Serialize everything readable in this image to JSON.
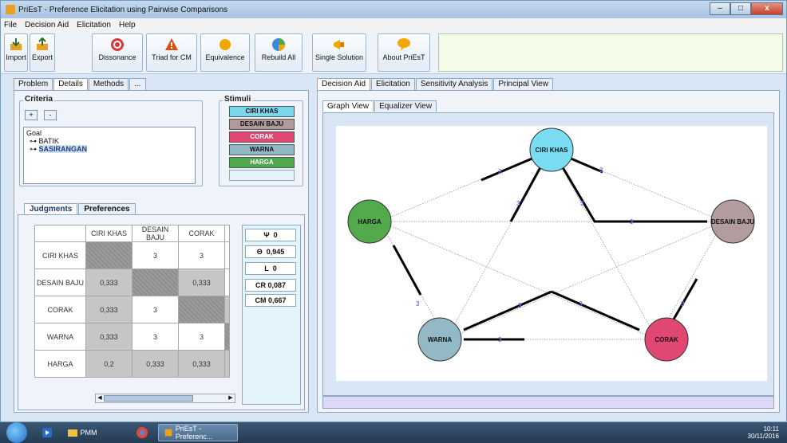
{
  "window": {
    "title": "PriEsT - Preference Elicitation using Pairwise Comparisons",
    "controls": [
      "–",
      "□",
      "x"
    ]
  },
  "menu": [
    "File",
    "Decision Aid",
    "Elicitation",
    "Help"
  ],
  "toolbar": [
    {
      "label": "Import",
      "icon": "import-icon",
      "color": "#e8a020"
    },
    {
      "label": "Export",
      "icon": "export-icon",
      "color": "#e8a020"
    },
    {
      "label": "Dissonance",
      "icon": "target-icon",
      "color": "#d83a3a"
    },
    {
      "label": "Triad for CM",
      "icon": "warning-icon",
      "color": "#e24a10"
    },
    {
      "label": "Equivalence",
      "icon": "sun-icon",
      "color": "#f0a800"
    },
    {
      "label": "Rebuild All",
      "icon": "pie-icon",
      "color": "#3a8ad8"
    },
    {
      "label": "Single Solution",
      "icon": "megaphone-icon",
      "color": "#f0a800"
    },
    {
      "label": "About PriEsT",
      "icon": "speech-icon",
      "color": "#f0a800"
    }
  ],
  "left_tabs": [
    "Problem",
    "Details",
    "Methods",
    "..."
  ],
  "criteria": {
    "title": "Criteria",
    "add_label": "+",
    "remove_label": "-",
    "tree": {
      "root": "Goal",
      "children": [
        "BATIK",
        "SASIRANGAN"
      ],
      "selected": "SASIRANGAN"
    }
  },
  "stimuli": {
    "title": "Stimuli",
    "items": [
      {
        "label": "CIRI KHAS",
        "color": "#7ad8ee"
      },
      {
        "label": "DESAIN BAJU",
        "color": "#b09a9c"
      },
      {
        "label": "CORAK",
        "color": "#e04873"
      },
      {
        "label": "WARNA",
        "color": "#92b8c6"
      },
      {
        "label": "HARGA",
        "color": "#4ea84e"
      }
    ]
  },
  "judgments": {
    "tabs": [
      "Judgments",
      "Preferences"
    ],
    "columns": [
      "CIRI KHAS",
      "DESAIN BAJU",
      "CORAK"
    ],
    "rows": [
      {
        "label": "CIRI KHAS",
        "cells": [
          "",
          "3",
          "3"
        ]
      },
      {
        "label": "DESAIN BAJU",
        "cells": [
          "0,333",
          "",
          "0,333"
        ]
      },
      {
        "label": "CORAK",
        "cells": [
          "0,333",
          "3",
          ""
        ]
      },
      {
        "label": "WARNA",
        "cells": [
          "0,333",
          "3",
          "3"
        ]
      },
      {
        "label": "HARGA",
        "cells": [
          "0,2",
          "0,333",
          "0,333"
        ]
      }
    ],
    "scroll_left": "◀",
    "scroll_right": "▶"
  },
  "metrics": [
    {
      "label": "Ψ",
      "value": "0"
    },
    {
      "label": "Θ",
      "value": "0,945"
    },
    {
      "label": "L",
      "value": "0"
    },
    {
      "label": "CR",
      "value": "0,087"
    },
    {
      "label": "CM",
      "value": "0,667"
    }
  ],
  "right_tabs": [
    "Decision Aid",
    "Elicitation",
    "Sensitivity Analysis",
    "Principal View"
  ],
  "graph_tabs": [
    "Graph View",
    "Equalizer View"
  ],
  "graph": {
    "nodes": [
      {
        "label": "CIRI KHAS",
        "color": "#7adcf0"
      },
      {
        "label": "DESAIN BAJU",
        "color": "#b29c9e"
      },
      {
        "label": "HARGA",
        "color": "#52aa4c"
      },
      {
        "label": "WARNA",
        "color": "#94b9c6"
      },
      {
        "label": "CORAK",
        "color": "#e04873"
      }
    ],
    "edge_label": "3"
  },
  "taskbar": {
    "items": [
      "PMM",
      "PriEsT - Preferenc..."
    ],
    "time": "10:11",
    "date": "30/11/2016"
  }
}
